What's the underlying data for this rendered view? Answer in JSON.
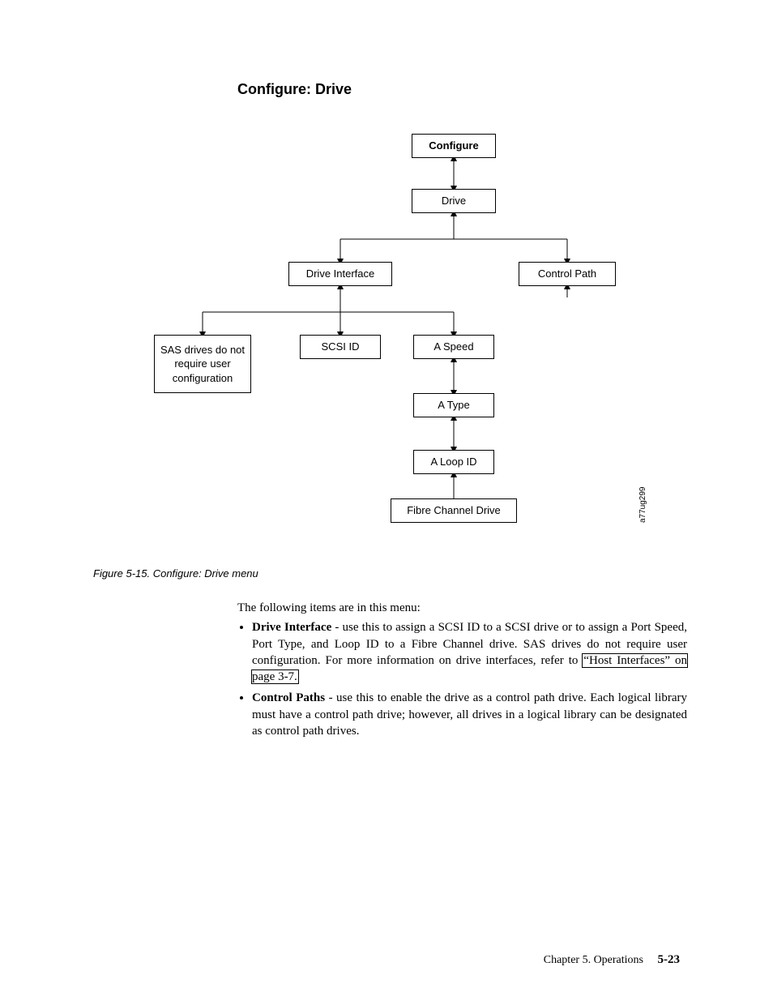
{
  "heading": "Configure: Drive",
  "diagram": {
    "configure": "Configure",
    "drive": "Drive",
    "driveInterface": "Drive Interface",
    "controlPath": "Control Path",
    "sas": "SAS drives do not require user configuration",
    "scsiId": "SCSI ID",
    "aSpeed": "A Speed",
    "aType": "A Type",
    "aLoopId": "A Loop ID",
    "fibre": "Fibre Channel Drive",
    "sideCode": "a77ug299"
  },
  "caption": "Figure 5-15. Configure: Drive menu",
  "intro": "The following items are in this menu:",
  "items": {
    "driveInterface": {
      "label": "Drive Interface",
      "textA": " - use this to assign a SCSI ID to a SCSI drive or to assign a Port Speed, Port Type, and Loop ID to a Fibre Channel drive. SAS drives do not require user configuration. For more information on drive interfaces, refer to ",
      "link": "“Host Interfaces” on page 3-7."
    },
    "controlPaths": {
      "label": "Control Paths",
      "text": " - use this to enable the drive as a control path drive. Each logical library must have a control path drive; however, all drives in a logical library can be designated as control path drives."
    }
  },
  "footer": {
    "chapter": "Chapter 5. Operations",
    "page": "5-23"
  }
}
